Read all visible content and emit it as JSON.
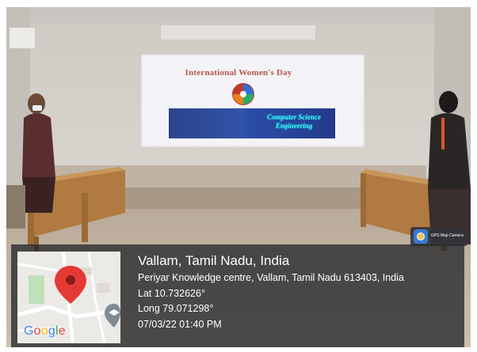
{
  "slide": {
    "title": "International Women's Day",
    "banner_text": "Computer Science Engineering"
  },
  "badge": {
    "label": "GPS Map Camera",
    "icon": "camera-pin-icon"
  },
  "map": {
    "google_letters": [
      "G",
      "o",
      "o",
      "g",
      "l",
      "e"
    ],
    "google_colors": [
      "#4285f4",
      "#ea4335",
      "#fbbc05",
      "#4285f4",
      "#34a853",
      "#ea4335"
    ],
    "pin_icon": "location-pin-icon",
    "place_icon": "graduation-cap-icon"
  },
  "location": {
    "place": "Vallam, Tamil Nadu, India",
    "address": "Periyar Knowledge centre, Vallam, Tamil Nadu 613403, India",
    "latitude": "Lat 10.732626°",
    "longitude": "Long 79.071298°",
    "datetime": "07/03/22 01:40 PM"
  },
  "colors": {
    "pin": "#e53935",
    "overlay": "#26282c",
    "wall": "#d6d1cb",
    "table": "#b5834a"
  }
}
